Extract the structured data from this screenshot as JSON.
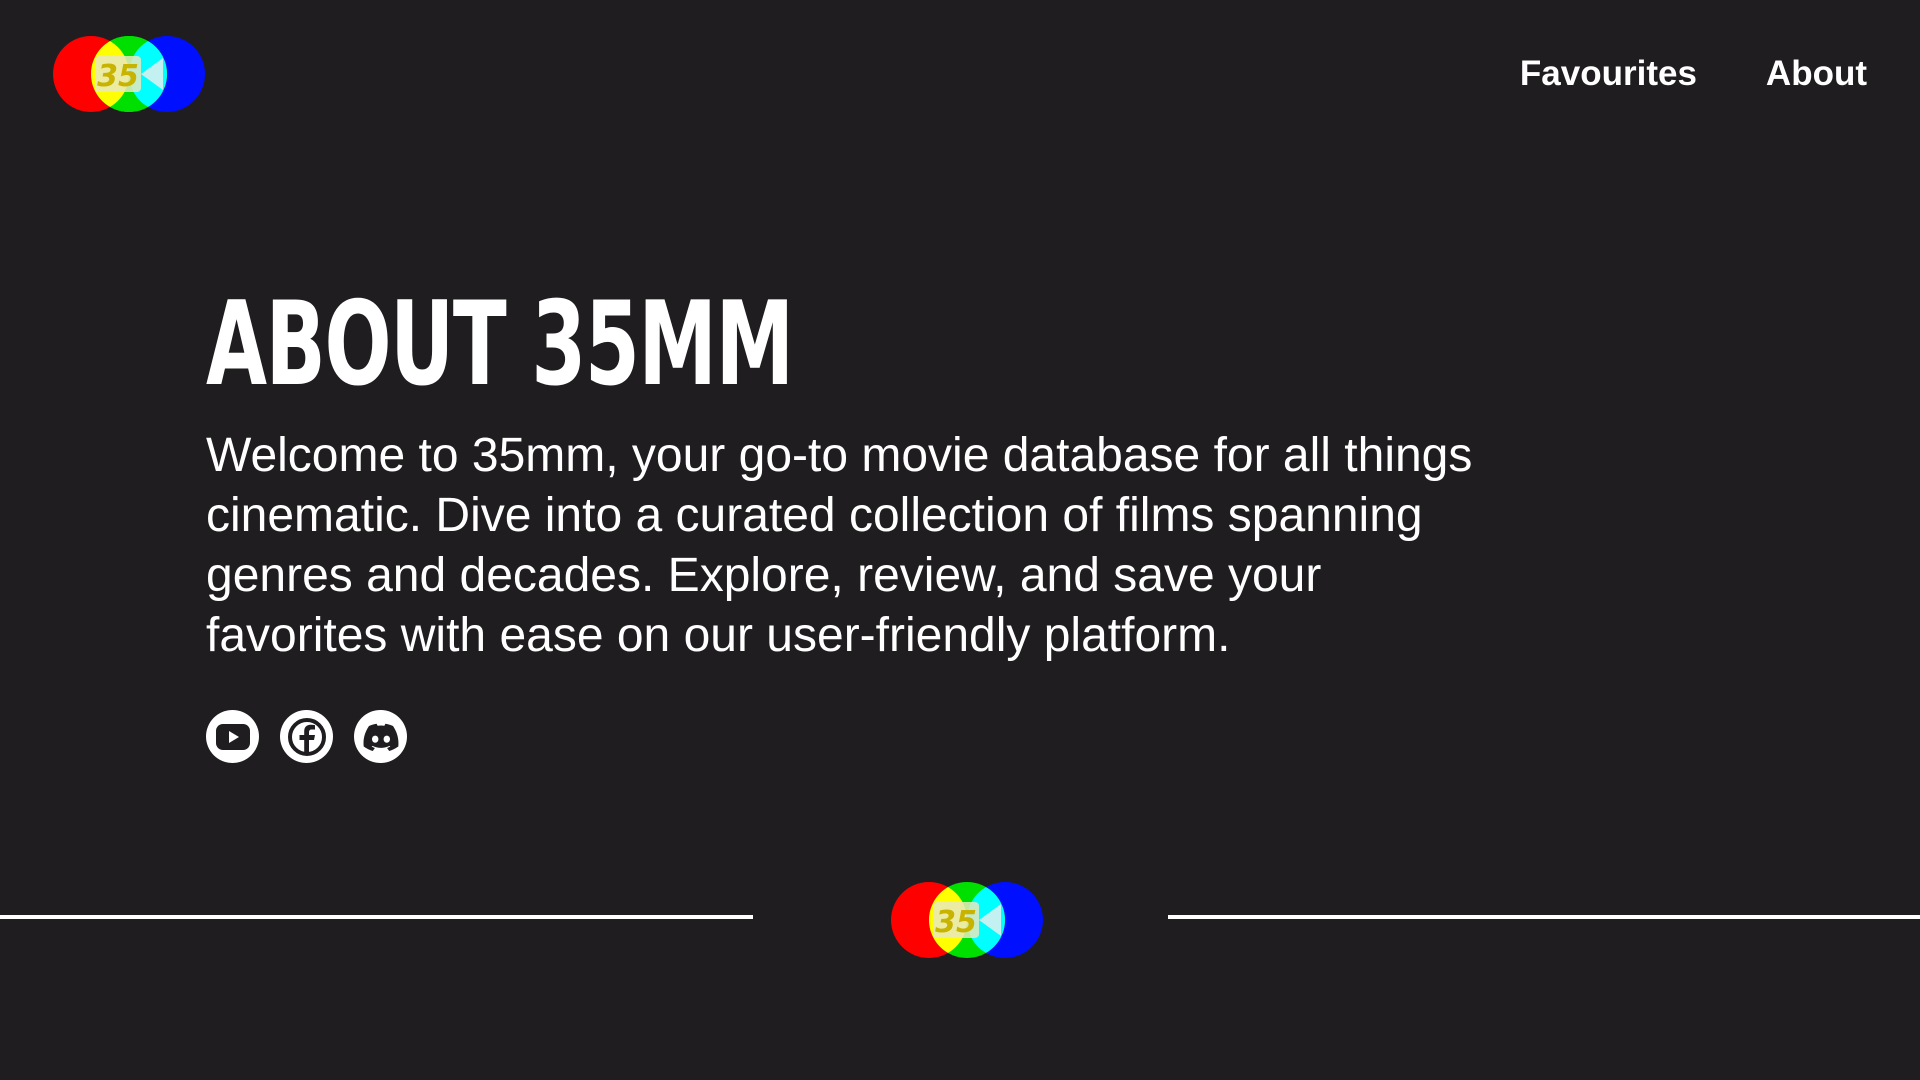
{
  "brand": {
    "logo_text": "35",
    "colors": {
      "red": "#ff0000",
      "green": "#00e000",
      "blue": "#0010ff",
      "background": "#1f1d1f"
    }
  },
  "nav": {
    "items": [
      {
        "label": "Favourites"
      },
      {
        "label": "About"
      }
    ]
  },
  "main": {
    "title": "ABOUT 35MM",
    "description": "Welcome to 35mm, your go-to movie database for all things cinematic. Dive into a curated collection of films spanning genres and decades. Explore, review, and save your favorites with ease on our user-friendly platform."
  },
  "socials": [
    {
      "icon": "youtube-icon"
    },
    {
      "icon": "facebook-icon"
    },
    {
      "icon": "discord-icon"
    }
  ]
}
